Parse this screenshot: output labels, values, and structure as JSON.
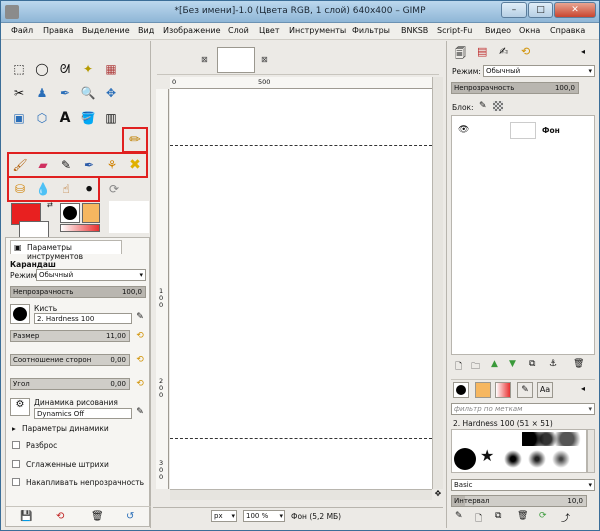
{
  "window": {
    "title": "*[Без имени]-1.0 (Цвета RGB, 1 слой) 640x400 – GIMP",
    "min_icon": "–",
    "max_icon": "□",
    "close_icon": "✕"
  },
  "menu": [
    "Файл",
    "Правка",
    "Выделение",
    "Вид",
    "Изображение",
    "Слой",
    "Цвет",
    "Инструменты",
    "Фильтры",
    "BNKSB",
    "Script-Fu",
    "Видео",
    "Окна",
    "Справка"
  ],
  "tool_options": {
    "tab_label": "Параметры инструментов",
    "tool_name": "Карандаш",
    "mode_label": "Режим:",
    "mode_value": "Обычный",
    "opacity_label": "Непрозрачность",
    "opacity_value": "100,0",
    "opacity_fraction": 1.0,
    "brush_label": "Кисть",
    "brush_value": "2. Hardness 100",
    "size_label": "Размер",
    "size_value": "11,00",
    "aspect_label": "Соотношение сторон",
    "aspect_value": "0,00",
    "angle_label": "Угол",
    "angle_value": "0,00",
    "dynamics_label": "Динамика рисования",
    "dynamics_value": "Dynamics Off",
    "dynamics_params": "Параметры динамики",
    "scatter": "Разброс",
    "smooth": "Сглаженные штрихи",
    "incremental": "Накапливать непрозрачность"
  },
  "colors": {
    "fg": "#e82020",
    "bg": "#ffffff",
    "highlight": "#e02020",
    "gradient_from": "#ffffff",
    "gradient_to": "#e83030",
    "pattern": "#f6b760"
  },
  "status": {
    "unit": "px",
    "zoom": "100 %",
    "info": "Фон (5,2 МБ)"
  },
  "layers": {
    "mode_label": "Режим:",
    "mode_value": "Обычный",
    "opacity_label": "Непрозрачность",
    "opacity_value": "100,0",
    "lock_label": "Блок:",
    "layer_name": "Фон"
  },
  "brushes": {
    "filter_placeholder": "фильтр по меткам",
    "brush_title": "2. Hardness 100 (51 × 51)",
    "category": "Basic",
    "spacing_label": "Интервал",
    "spacing_value": "10,0",
    "aa_label": "Aa"
  },
  "ruler": {
    "h_ticks": [
      "0",
      "500"
    ],
    "v_ticks": [
      "1",
      "0",
      "0",
      "2",
      "0",
      "0",
      "3",
      "0",
      "0"
    ]
  }
}
